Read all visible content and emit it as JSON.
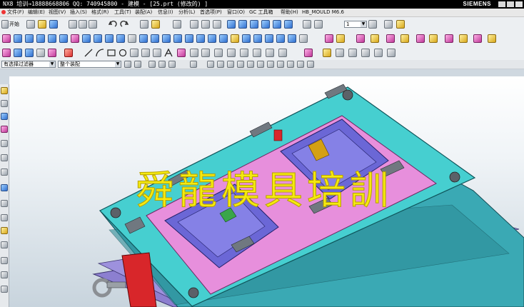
{
  "window": {
    "title": "NX8 培训→18888668806 QQ: 740945800 - 建模 - [25.prt  (修改的) ]",
    "brand": "SIEMENS"
  },
  "menu": {
    "items": [
      "文件(F)",
      "编辑(E)",
      "视图(V)",
      "插入(S)",
      "格式(R)",
      "工具(T)",
      "装配(A)",
      "信息(I)",
      "分析(L)",
      "首选项(P)",
      "窗口(O)",
      "GC 工具箱",
      "帮助(H)",
      "HB_MOULD M6.6"
    ]
  },
  "toolbar": {
    "start_label": "开始",
    "layer_value": "1"
  },
  "selection_bar": {
    "filter_value": "有选择过滤器",
    "scope_value": "整个装配"
  },
  "overlay": {
    "watermark": "舜龍模具培訓"
  },
  "colors": {
    "mold_base": "#3fc7c7",
    "cavity_plate": "#e38ad8",
    "part": "#6b67d6",
    "clamp": "#d8262a",
    "bottom_plate": "#8c7fd0"
  }
}
